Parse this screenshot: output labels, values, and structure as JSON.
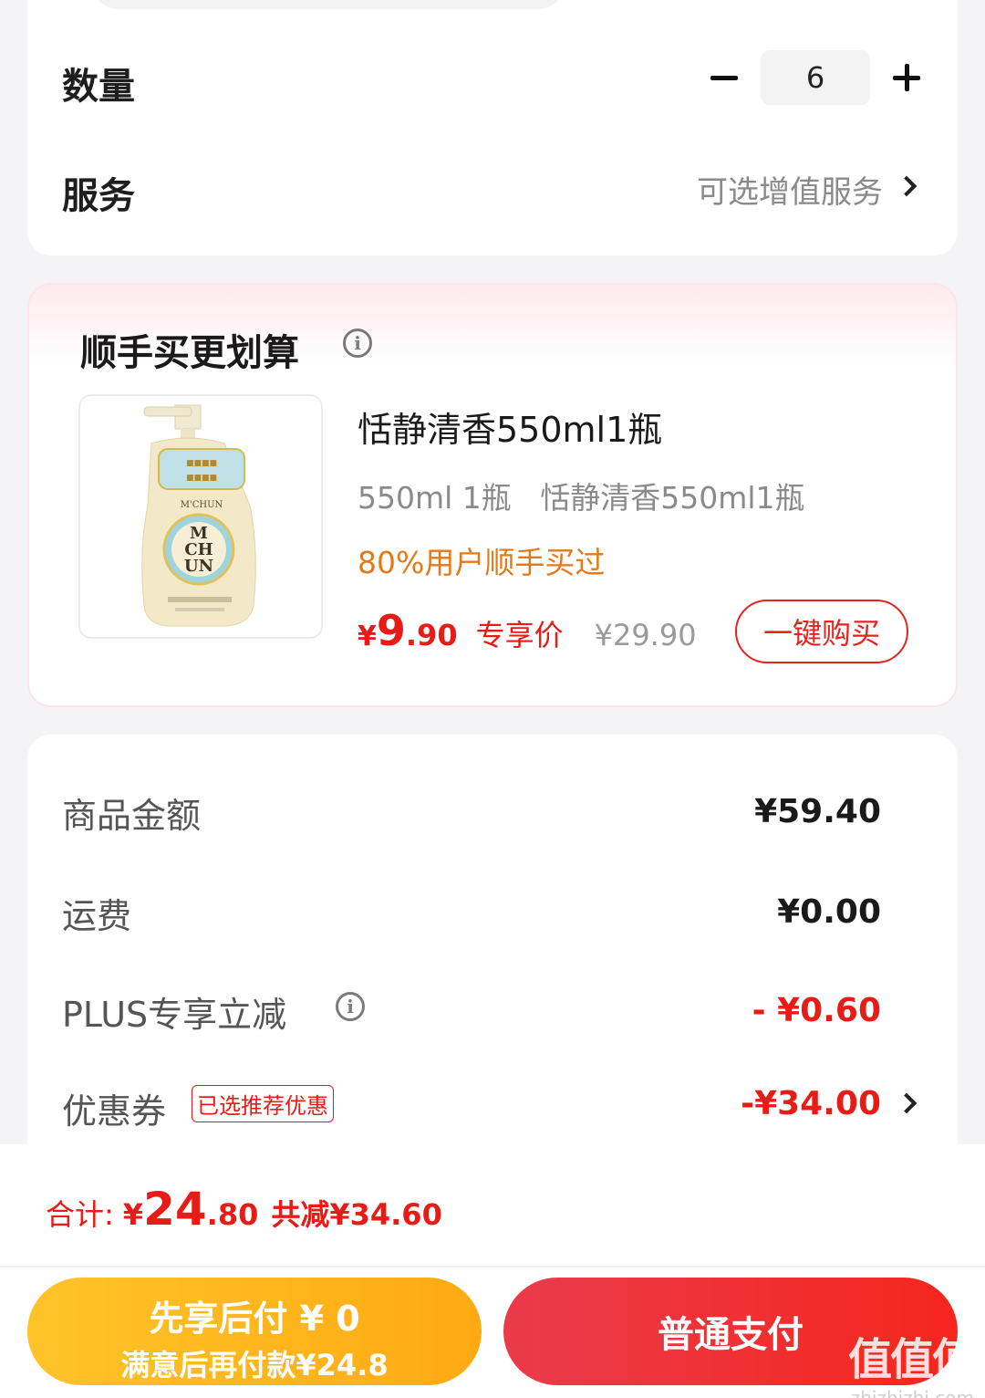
{
  "quantity": {
    "label": "数量",
    "value": "6"
  },
  "service": {
    "label": "服务",
    "value": "可选增值服务"
  },
  "addon": {
    "title": "顺手买更划算",
    "product": {
      "name": "恬静清香550ml1瓶",
      "spec": "550ml 1瓶   恬静清香550ml1瓶",
      "hint": "80%用户顺手买过",
      "price_currency": "¥",
      "price_int": "9",
      "price_dec": ".90",
      "price_tag": "专享价",
      "original_price": "¥29.90",
      "buy_label": "一键购买",
      "image_brand": "M'CHUN",
      "image_logo_line1": "M",
      "image_logo_line2": "CH",
      "image_logo_line3": "UN"
    }
  },
  "summary": {
    "goods_label": "商品金额",
    "goods_value": "¥59.40",
    "shipping_label": "运费",
    "shipping_value": "¥0.00",
    "plus_label": "PLUS专享立减",
    "plus_value": "- ¥0.60",
    "coupon_label": "优惠券",
    "coupon_tag": "已选推荐优惠",
    "coupon_value": "-¥34.00"
  },
  "bottom": {
    "total_label": "合计:",
    "total_currency": "¥",
    "total_int": "24",
    "total_dec": ".80",
    "total_saved": "共减¥34.60",
    "pay_later_line1": "先享后付 ¥ 0",
    "pay_later_line2": "满意后再付款¥24.8",
    "pay_now": "普通支付"
  },
  "watermark": {
    "logo": "值值值",
    "url": "zhizhizhi.com"
  },
  "colors": {
    "accent_red": "#e81c17",
    "hint_orange": "#e37a19",
    "pay_later_yellow": "#ffb51f",
    "pay_red": "#f02d2c"
  }
}
